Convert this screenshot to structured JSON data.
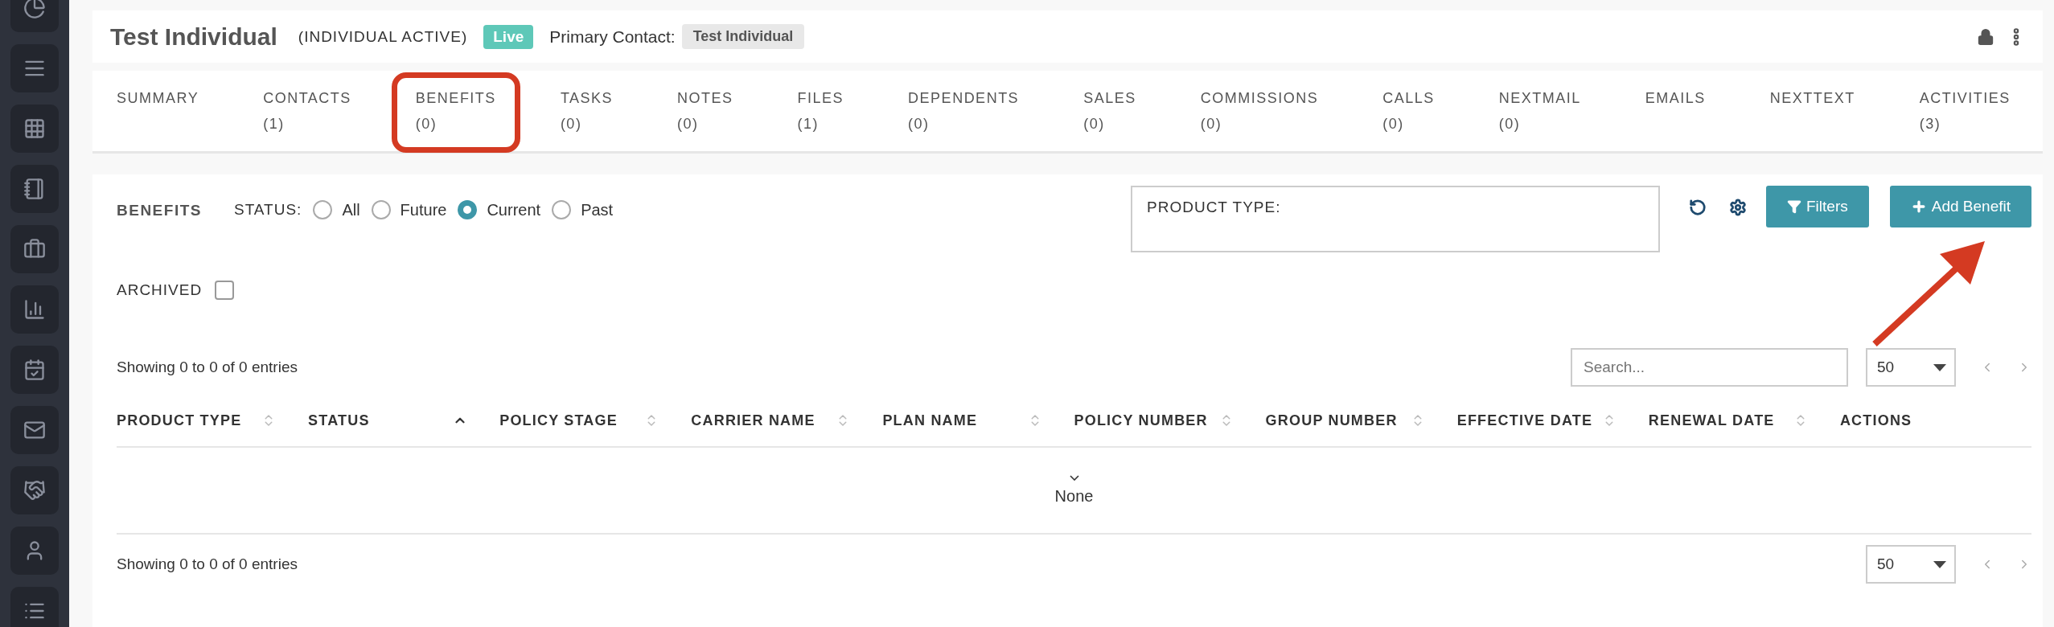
{
  "header": {
    "title": "Test Individual",
    "status": "(INDIVIDUAL ACTIVE)",
    "badge": "Live",
    "contact_label": "Primary Contact:",
    "contact": "Test Individual"
  },
  "tabs": [
    {
      "label": "SUMMARY",
      "highlighted": false
    },
    {
      "label": "CONTACTS",
      "count": "(1)",
      "highlighted": false
    },
    {
      "label": "BENEFITS",
      "count": "(0)",
      "highlighted": true
    },
    {
      "label": "TASKS",
      "count": "(0)",
      "highlighted": false
    },
    {
      "label": "NOTES",
      "count": "(0)",
      "highlighted": false
    },
    {
      "label": "FILES",
      "count": "(1)",
      "highlighted": false
    },
    {
      "label": "DEPENDENTS",
      "count": "(0)",
      "highlighted": false
    },
    {
      "label": "SALES",
      "count": "(0)",
      "highlighted": false
    },
    {
      "label": "COMMISSIONS",
      "count": "(0)",
      "highlighted": false
    },
    {
      "label": "CALLS",
      "count": "(0)",
      "highlighted": false
    },
    {
      "label": "NEXTMAIL",
      "count": "(0)",
      "highlighted": false
    },
    {
      "label": "EMAILS",
      "highlighted": false
    },
    {
      "label": "NEXTTEXT",
      "highlighted": false
    },
    {
      "label": "ACTIVITIES",
      "count": "(3)",
      "highlighted": false
    }
  ],
  "filters": {
    "section": "BENEFITS",
    "status_label": "STATUS:",
    "status_options": [
      {
        "label": "All",
        "selected": false
      },
      {
        "label": "Future",
        "selected": false
      },
      {
        "label": "Current",
        "selected": true
      },
      {
        "label": "Past",
        "selected": false
      }
    ],
    "archived": {
      "label": "ARCHIVED",
      "checked": false
    },
    "product_type": {
      "label": "PRODUCT TYPE:"
    },
    "buttons": [
      {
        "label": "Filters",
        "kind": "filter"
      },
      {
        "label": "Add Benefit",
        "kind": "add"
      }
    ]
  },
  "table": {
    "info": "Showing 0 to 0 of 0 entries",
    "search": {
      "placeholder": "Search..."
    },
    "page_size": "50",
    "columns": [
      {
        "label": "PRODUCT TYPE",
        "kind": "sortable"
      },
      {
        "label": "STATUS",
        "kind": "sorted"
      },
      {
        "label": "POLICY STAGE",
        "kind": "sortable"
      },
      {
        "label": "CARRIER NAME",
        "kind": "sortable"
      },
      {
        "label": "PLAN NAME",
        "kind": "sortable"
      },
      {
        "label": "POLICY NUMBER",
        "kind": "sortable"
      },
      {
        "label": "GROUP NUMBER",
        "kind": "sortable"
      },
      {
        "label": "EFFECTIVE DATE",
        "kind": "sortable"
      },
      {
        "label": "RENEWAL DATE",
        "kind": "sortable"
      },
      {
        "label": "ACTIONS",
        "kind": "plain"
      }
    ],
    "empty": "None"
  },
  "footer": {
    "info": "Showing 0 to 0 of 0 entries",
    "page_size": "50"
  }
}
